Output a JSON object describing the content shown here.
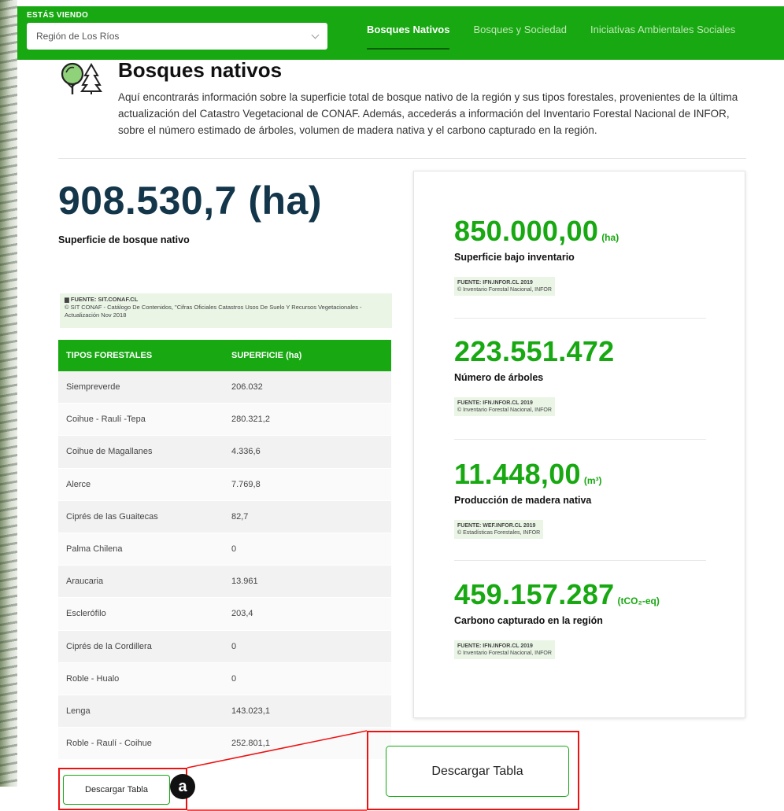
{
  "header": {
    "viewing_label": "ESTÁS VIENDO",
    "region_selected": "Región de Los Ríos",
    "nav": [
      {
        "label": "Bosques Nativos",
        "active": true
      },
      {
        "label": "Bosques y Sociedad",
        "active": false
      },
      {
        "label": "Iniciativas Ambientales Sociales",
        "active": false
      }
    ],
    "brand_color": "#18a812"
  },
  "section": {
    "title": "Bosques nativos",
    "intro": "Aquí encontrarás información sobre la superficie total de bosque nativo de la región y sus tipos forestales, provenientes de la última actualización del Catastro Vegetacional de CONAF. Además, accederás a información del Inventario Forestal Nacional de INFOR, sobre el número estimado de árboles, volumen de madera nativa y el carbono capturado en la región."
  },
  "surface": {
    "value": "908.530,7 (ha)",
    "label": "Superficie de bosque nativo",
    "source_title": "FUENTE: SIT.CONAF.CL",
    "source_detail": "© SIT CONAF - Catálogo De Contenidos, \"Cifras Oficiales Catastros Usos De Suelo Y Recursos Vegetacionales - Actualización Nov 2018"
  },
  "table": {
    "headers": [
      "TIPOS FORESTALES",
      "SUPERFICIE (ha)"
    ],
    "rows": [
      [
        "Siempreverde",
        "206.032"
      ],
      [
        "Coihue - Raulí -Tepa",
        "280.321,2"
      ],
      [
        "Coihue de Magallanes",
        "4.336,6"
      ],
      [
        "Alerce",
        "7.769,8"
      ],
      [
        "Ciprés de las Guaitecas",
        "82,7"
      ],
      [
        "Palma Chilena",
        "0"
      ],
      [
        "Araucaria",
        "13.961"
      ],
      [
        "Esclerófilo",
        "203,4"
      ],
      [
        "Ciprés de la Cordillera",
        "0"
      ],
      [
        "Roble - Hualo",
        "0"
      ],
      [
        "Lenga",
        "143.023,1"
      ],
      [
        "Roble - Raulí - Coihue",
        "252.801,1"
      ]
    ]
  },
  "stats": [
    {
      "value": "850.000,00",
      "unit": "(ha)",
      "label": "Superficie bajo inventario",
      "source_title": "FUENTE: IFN.INFOR.CL 2019",
      "source_detail": "© Inventario Forestal Nacional, INFOR"
    },
    {
      "value": "223.551.472",
      "unit": "",
      "label": "Número de árboles",
      "source_title": "FUENTE: IFN.INFOR.CL 2019",
      "source_detail": "© Inventario Forestal Nacional, INFOR"
    },
    {
      "value": "11.448,00",
      "unit": "(m³)",
      "label": "Producción de madera nativa",
      "source_title": "FUENTE: WEF.INFOR.CL 2019",
      "source_detail": "© Estadísticas Forestales, INFOR"
    },
    {
      "value": "459.157.287",
      "unit": "(tCO₂-eq)",
      "label": "Carbono capturado en la región",
      "source_title": "FUENTE: IFN.INFOR.CL 2019",
      "source_detail": "© Inventario Forestal Nacional, INFOR"
    }
  ],
  "download": {
    "label": "Descargar Tabla",
    "badge": "a"
  }
}
